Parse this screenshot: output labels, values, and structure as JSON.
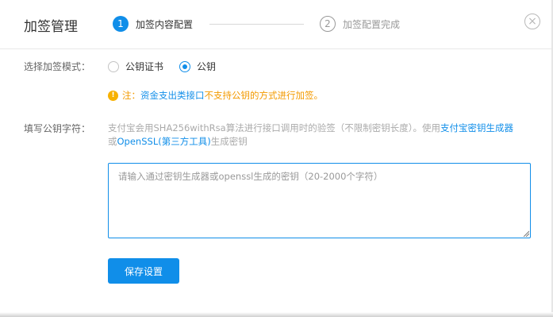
{
  "dialog": {
    "title": "加签管理",
    "close_icon": "close-circle-icon"
  },
  "steps": [
    {
      "number": "1",
      "label": "加签内容配置",
      "active": true
    },
    {
      "number": "2",
      "label": "加签配置完成",
      "active": false
    }
  ],
  "mode": {
    "label": "选择加签模式：",
    "options": [
      {
        "label": "公钥证书",
        "checked": false
      },
      {
        "label": "公钥",
        "checked": true
      }
    ]
  },
  "notice": {
    "icon": "warning-icon",
    "prefix": "注：",
    "link": "资金支出类接口",
    "rest": "不支持公钥的方式进行加签。"
  },
  "public_key": {
    "label": "填写公钥字符：",
    "desc_part1": "支付宝会用SHA256withRsa算法进行接口调用时的验签（不限制密钥长度）。使用",
    "desc_link1": "支付宝密钥生成器",
    "desc_part2": "或",
    "desc_link2": "OpenSSL(第三方工具)",
    "desc_part3": "生成密钥",
    "placeholder": "请输入通过密钥生成器或openssl生成的密钥（20-2000个字符）",
    "value": ""
  },
  "save_button": {
    "label": "保存设置"
  },
  "colors": {
    "primary": "#108ee9",
    "warning": "#f39a00",
    "muted": "#aaaaaa"
  }
}
